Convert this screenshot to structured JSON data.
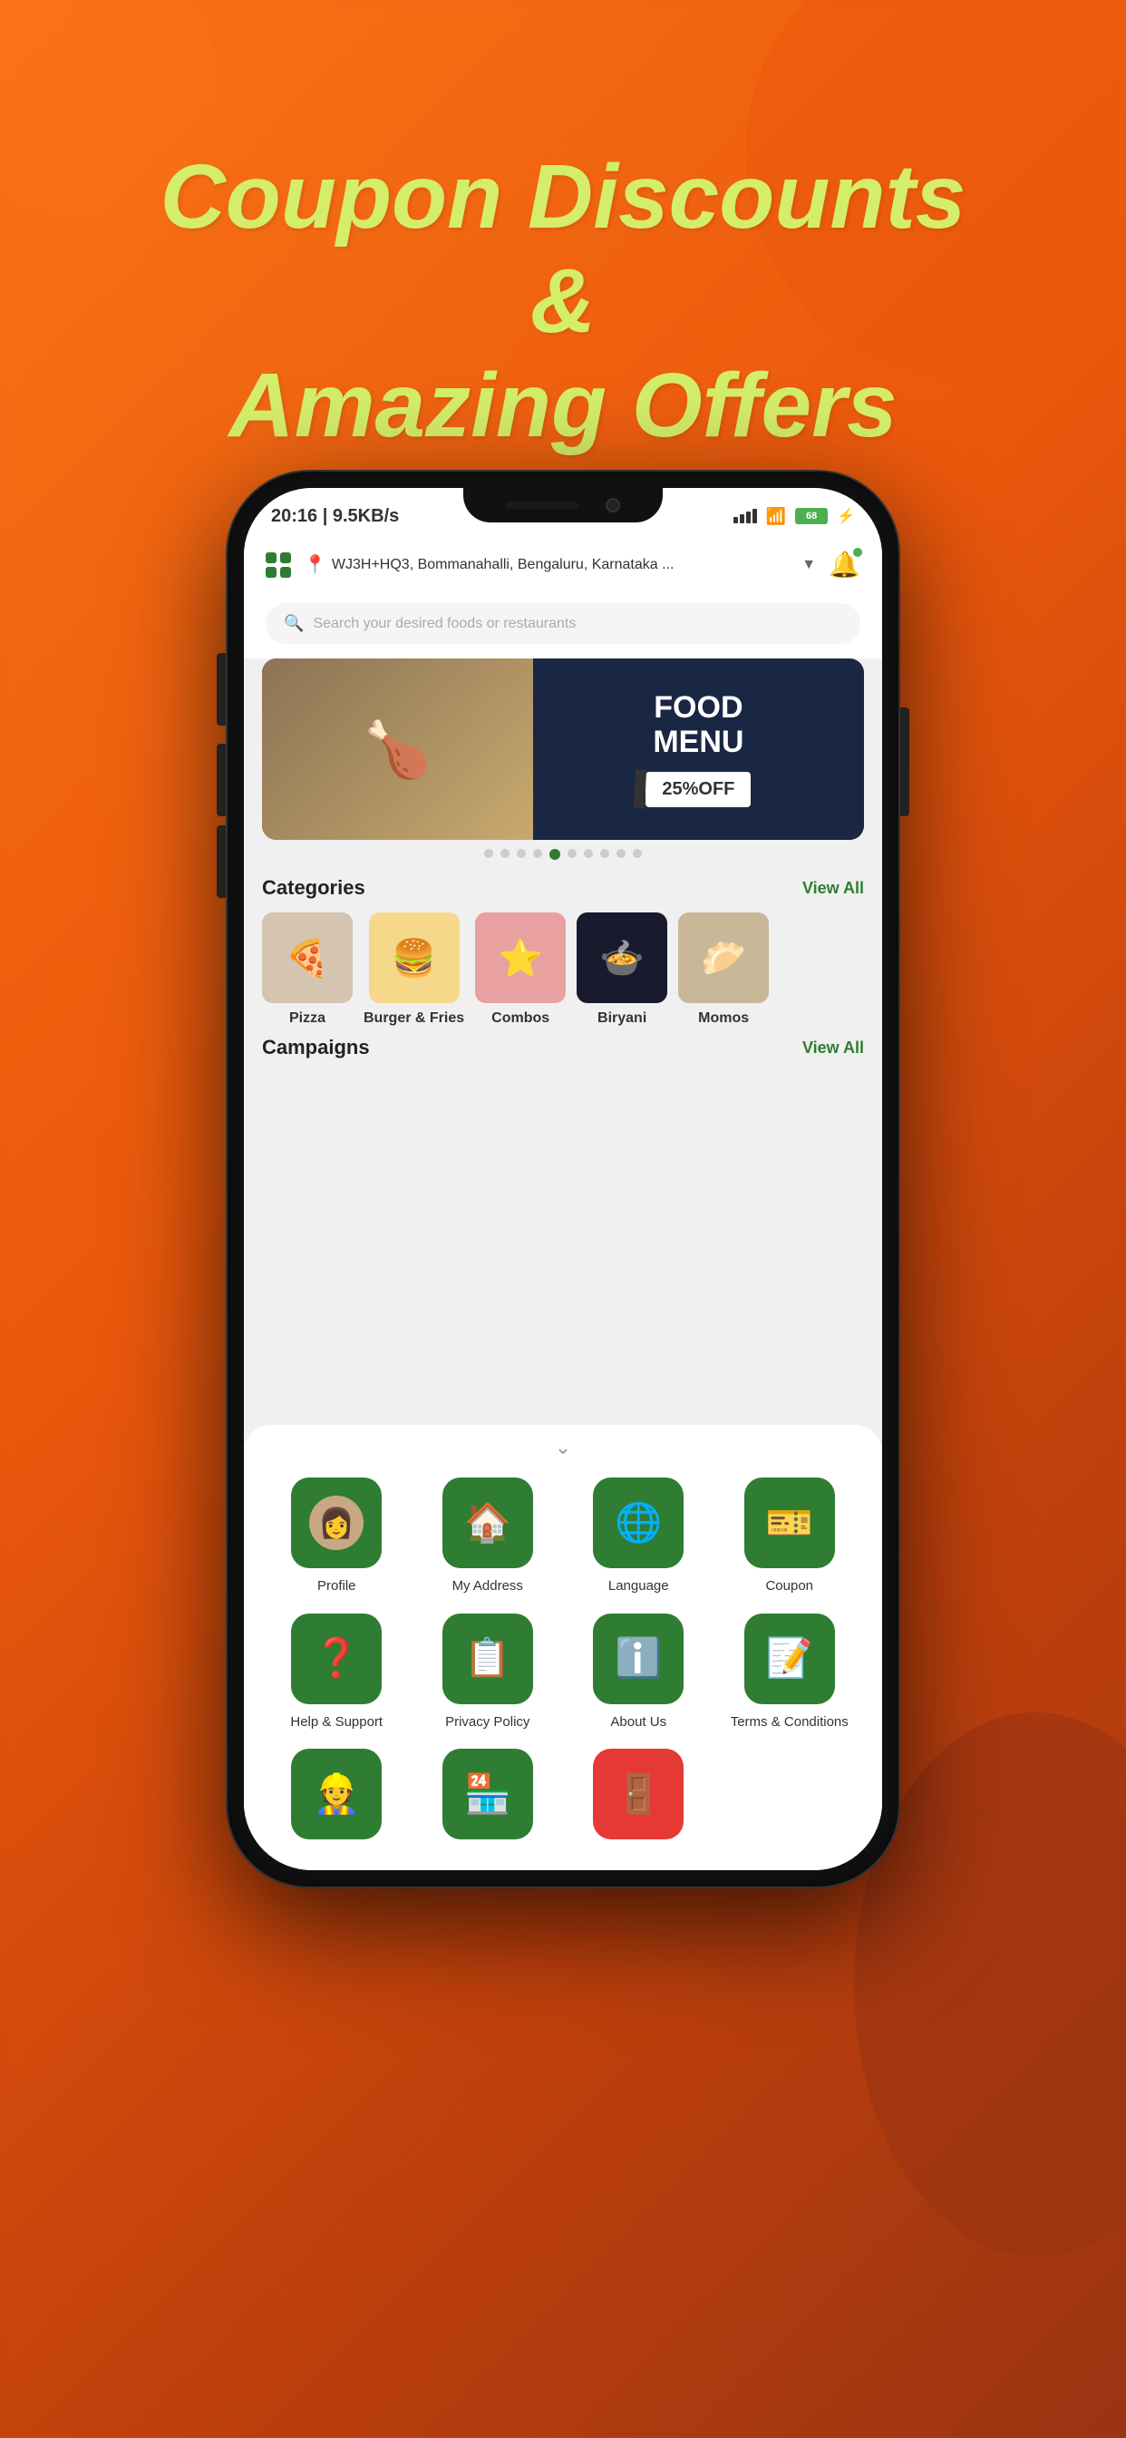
{
  "page": {
    "background_headline_line1": "Coupon Discounts",
    "background_headline_line2": "&",
    "background_headline_line3": "Amazing Offers"
  },
  "status_bar": {
    "time": "20:16",
    "network_speed": "9.5KB/s",
    "battery_percent": "68",
    "battery_label": "68"
  },
  "top_bar": {
    "location": "WJ3H+HQ3, Bommanahalli, Bengaluru, Karnataka ...",
    "grid_icon": "grid-icon",
    "pin_icon": "📍",
    "bell_icon": "🔔"
  },
  "search": {
    "placeholder": "Search your desired foods or restaurants"
  },
  "banner": {
    "title_line1": "FOOD",
    "title_line2": "MENU",
    "offer": "25%OFF"
  },
  "banner_dots": {
    "total": 10,
    "active_index": 4
  },
  "categories": {
    "title": "Categories",
    "view_all": "View All",
    "items": [
      {
        "label": "Pizza",
        "emoji": "🍕",
        "style": "pizza"
      },
      {
        "label": "Burger & Fries",
        "emoji": "🍔",
        "style": "burger"
      },
      {
        "label": "Combos",
        "emoji": "⭐",
        "style": "combos"
      },
      {
        "label": "Biryani",
        "emoji": "🍲",
        "style": "biryani"
      },
      {
        "label": "Momos",
        "emoji": "🥟",
        "style": "momos"
      }
    ]
  },
  "campaigns": {
    "title": "Campaigns",
    "view_all": "View All"
  },
  "bottom_sheet": {
    "handle": "⌄",
    "menu_items": [
      {
        "id": "profile",
        "label": "Profile",
        "icon": "👤",
        "color": "green",
        "has_avatar": true
      },
      {
        "id": "my-address",
        "label": "My Address",
        "icon": "🏠",
        "color": "green"
      },
      {
        "id": "language",
        "label": "Language",
        "icon": "🌐",
        "color": "green"
      },
      {
        "id": "coupon",
        "label": "Coupon",
        "icon": "🎫",
        "color": "green"
      },
      {
        "id": "help-support",
        "label": "Help & Support",
        "icon": "❓",
        "color": "green"
      },
      {
        "id": "privacy-policy",
        "label": "Privacy Policy",
        "icon": "📋",
        "color": "green"
      },
      {
        "id": "about-us",
        "label": "About Us",
        "icon": "ℹ️",
        "color": "green"
      },
      {
        "id": "terms-conditions",
        "label": "Terms & Conditions",
        "icon": "📝",
        "color": "green"
      },
      {
        "id": "more-1",
        "label": "",
        "icon": "👷",
        "color": "green"
      },
      {
        "id": "more-2",
        "label": "",
        "icon": "🏪",
        "color": "green"
      },
      {
        "id": "logout",
        "label": "",
        "icon": "🚪",
        "color": "red"
      }
    ]
  }
}
